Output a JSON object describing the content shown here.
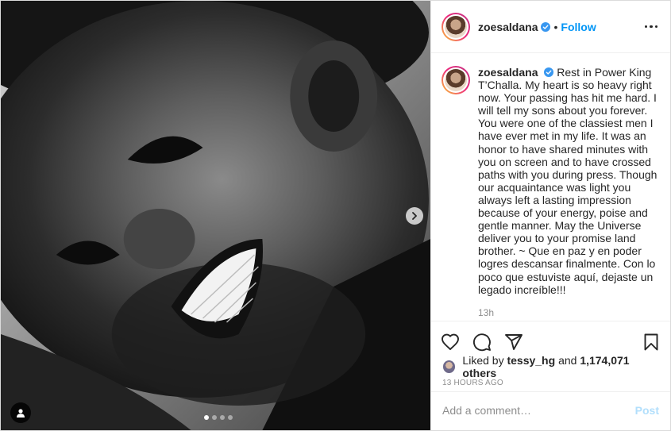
{
  "post": {
    "username": "zoesaldana",
    "follow_label": "Follow",
    "separator": "•",
    "caption": "Rest in Power King T’Challa. My heart is so heavy right now. Your passing has hit me hard. I will tell my sons about you forever. You were one of the classiest men I have ever met in my life. It was an honor to have shared minutes with you on screen and to have crossed paths with you during press. Though our acquaintance was light you always left a lasting impression because of your energy, poise and gentle manner. May the Universe deliver you to your promise land brother. ~ Que en paz y en poder logres descansar finalmente. Con lo poco que estuviste aquí, dejaste un legado increíble!!!",
    "caption_age": "13h",
    "liked_prefix": "Liked by",
    "liked_user": "tessy_hg",
    "liked_and": "and",
    "liked_count": "1,174,071 others",
    "timestamp": "13 HOURS AGO",
    "comment_placeholder": "Add a comment…",
    "post_label": "Post"
  },
  "carousel": {
    "slides": 4,
    "active": 0
  },
  "colors": {
    "accent": "#0095f6",
    "verified": "#3897f0",
    "post_disabled": "#b2dffc",
    "muted": "#8e8e8e"
  },
  "icons": [
    "next-arrow-icon",
    "user-tag-icon",
    "more-options-icon",
    "verified-badge-icon",
    "heart-icon",
    "comment-icon",
    "share-icon",
    "bookmark-icon"
  ]
}
